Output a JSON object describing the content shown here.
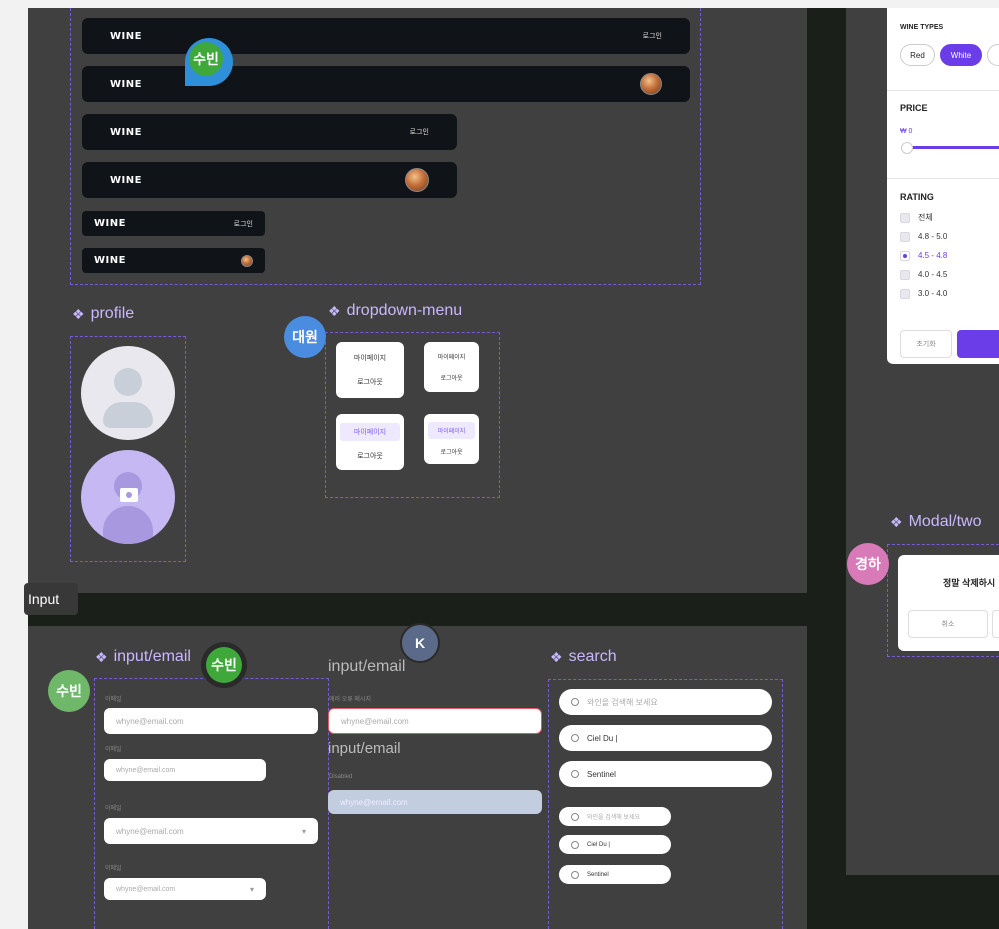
{
  "colors": {
    "accent": "#6a3de8",
    "frame": "#404040",
    "canvas": "#1a2019",
    "dashed": "#7a5ad8"
  },
  "gnb": {
    "logo": "WINE",
    "login": "로그인"
  },
  "cursors": {
    "subin": "수빈",
    "daewon": "대원",
    "gyeongha": "경하",
    "k": "K"
  },
  "sections": {
    "profile": "profile",
    "dropdown": "dropdown-menu",
    "input_frame": "Input",
    "input_email": "input/email",
    "input_email_2": "input/email",
    "input_email_3": "input/email",
    "search": "search",
    "modal": "Modal/two"
  },
  "dropdown": {
    "mypage": "마이페이지",
    "logout": "로그아웃"
  },
  "inputs": {
    "label": "이메일",
    "label_error": "에러 오류 메시지",
    "label_disabled": "Disabled",
    "placeholder": "whyne@email.com"
  },
  "search": {
    "placeholder": "와인을 검색해 보세요",
    "value_1": "Ciel Du |",
    "value_2": "Sentinel"
  },
  "filter": {
    "wine_types_title": "WINE TYPES",
    "types": [
      "Red",
      "White"
    ],
    "price_title": "PRICE",
    "price_value": "₩ 0",
    "rating_title": "RATING",
    "ratings": [
      "전체",
      "4.8 - 5.0",
      "4.5 - 4.8",
      "4.0 - 4.5",
      "3.0 - 4.0"
    ],
    "reset": "초기화"
  },
  "modal": {
    "message": "정말 삭제하시",
    "cancel": "취소"
  }
}
